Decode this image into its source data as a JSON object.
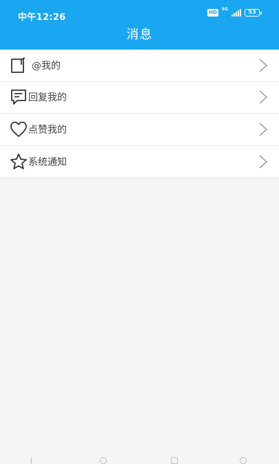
{
  "status_bar": {
    "time": "中午12:26",
    "hd": "HD",
    "network": "5G",
    "battery": "53"
  },
  "header": {
    "title": "消息",
    "background_color": "#1aa6f0"
  },
  "menu": {
    "items": [
      {
        "label": "@我的",
        "icon": "bookmark-icon"
      },
      {
        "label": "回复我的",
        "icon": "comment-icon"
      },
      {
        "label": "点赞我的",
        "icon": "heart-icon"
      },
      {
        "label": "系统通知",
        "icon": "star-icon"
      }
    ]
  }
}
